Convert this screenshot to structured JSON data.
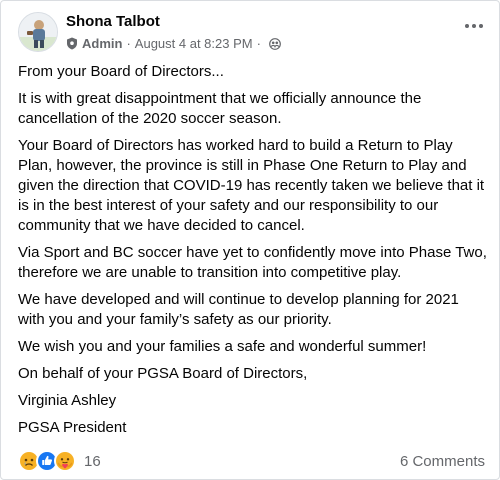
{
  "post": {
    "author": "Shona Talbot",
    "role": "Admin",
    "separator": "·",
    "timestamp": "August 4 at 8:23 PM",
    "paragraphs": [
      "From your Board of Directors...",
      "It is with great disappointment that we officially announce the cancellation of the 2020 soccer season.",
      "Your Board of Directors has worked hard to build a Return to Play Plan, however, the province is still in Phase One Return to Play and given the direction that COVID-19 has recently taken we believe that it is in the best interest of your safety and our responsibility to our community that we have decided to cancel.",
      "Via Sport and BC soccer have yet to confidently move into Phase Two, therefore we are unable to transition into competitive play.",
      "We have developed and will continue to develop planning for 2021 with you and your family’s safety as our priority.",
      "We wish you and your families a safe and wonderful summer!",
      "On behalf of your PGSA Board of Directors,",
      "Virginia Ashley",
      "PGSA President"
    ]
  },
  "footer": {
    "reaction_icons": [
      "sad-reaction-icon",
      "like-reaction-icon",
      "care-reaction-icon"
    ],
    "reaction_count": "16",
    "comments": "6 Comments"
  },
  "colors": {
    "text": "#050505",
    "secondary_text": "#65676b",
    "like_blue": "#1877f2",
    "sad_yellow": "#f7b125",
    "border": "#dadde1"
  }
}
